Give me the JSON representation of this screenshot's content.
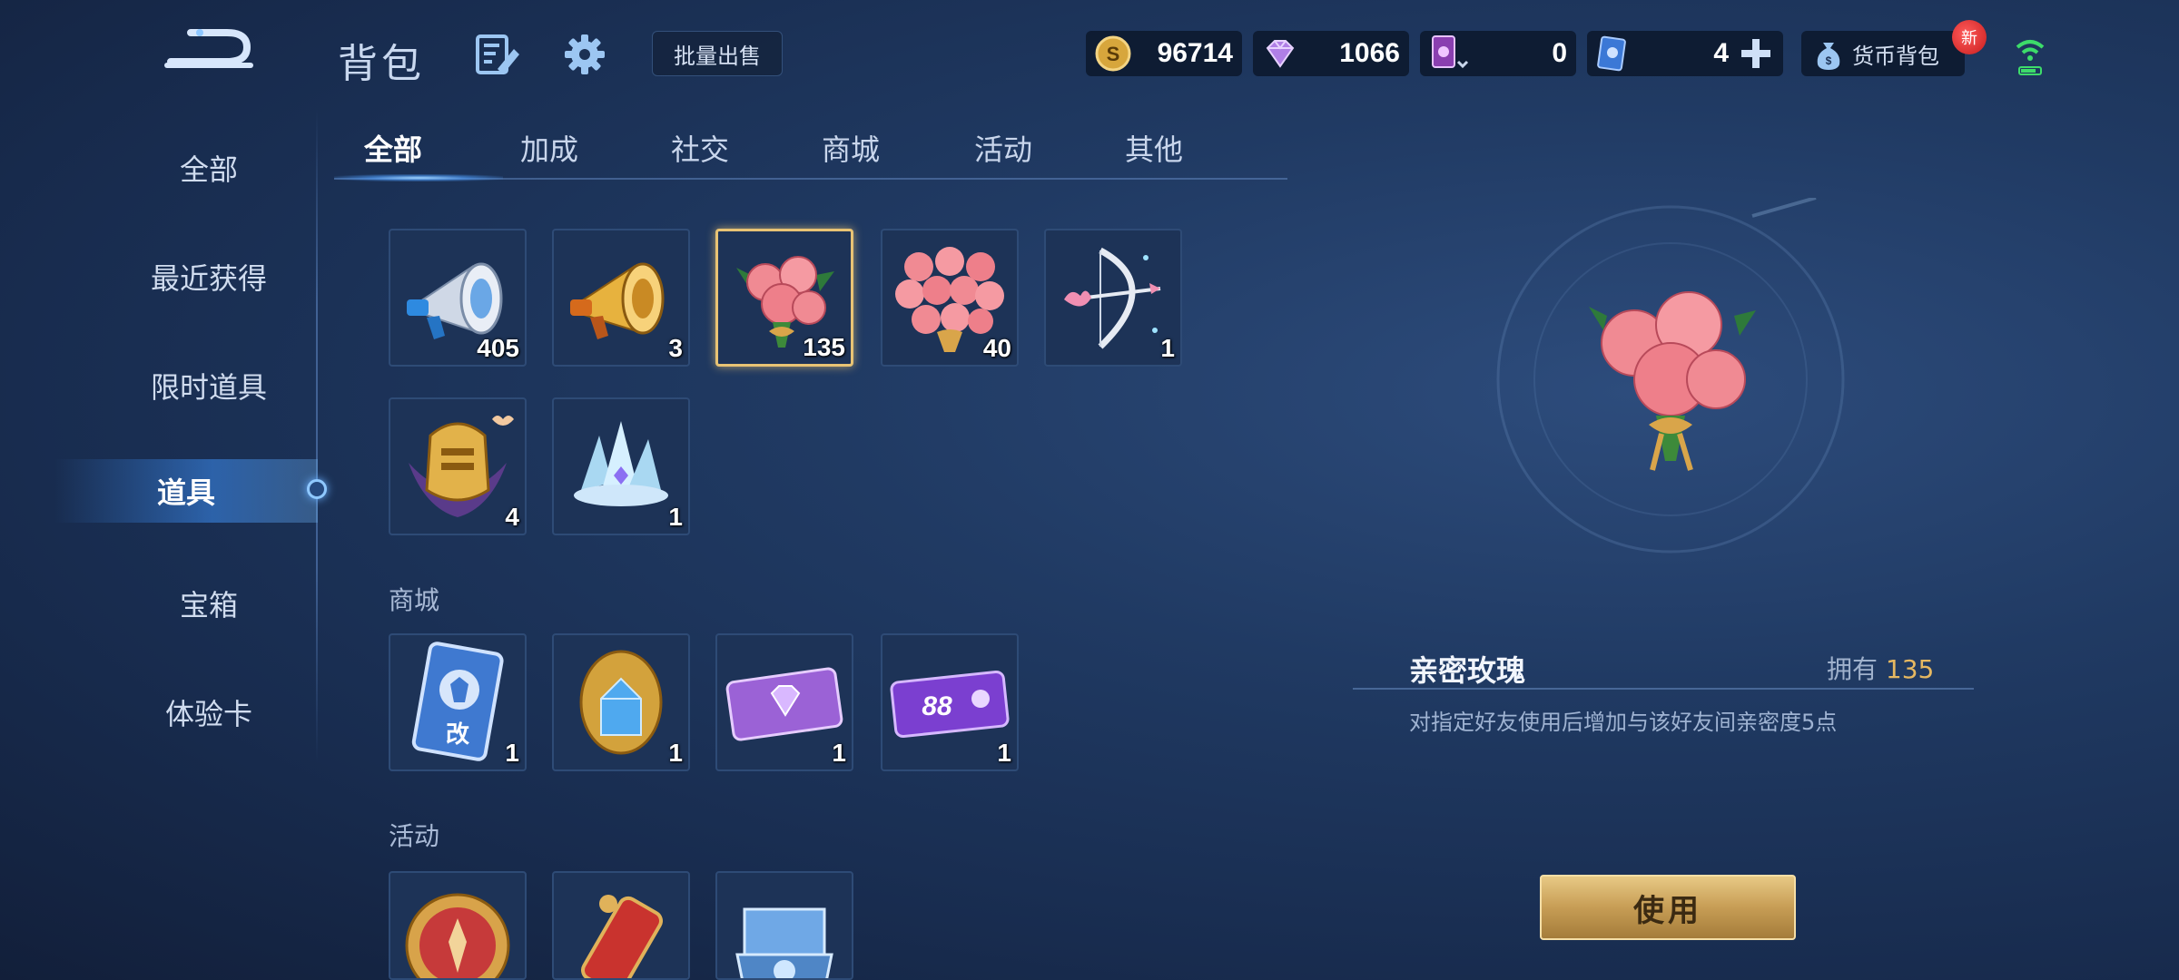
{
  "header": {
    "title": "背包",
    "bulk_sell_label": "批量出售",
    "currencies": [
      {
        "icon": "gold-coin-icon",
        "value": "96714"
      },
      {
        "icon": "diamond-icon",
        "value": "1066"
      },
      {
        "icon": "ticket-icon",
        "value": "0"
      },
      {
        "icon": "card-icon",
        "value": "4"
      }
    ],
    "currency_bag_label": "货币背包",
    "new_badge": "新"
  },
  "sidebar": {
    "items": [
      {
        "label": "全部",
        "active": false
      },
      {
        "label": "最近获得",
        "active": false
      },
      {
        "label": "限时道具",
        "active": false
      },
      {
        "label": "道具",
        "active": true
      },
      {
        "label": "宝箱",
        "active": false
      },
      {
        "label": "体验卡",
        "active": false
      }
    ]
  },
  "tabs": [
    {
      "label": "全部",
      "active": true
    },
    {
      "label": "加成",
      "active": false
    },
    {
      "label": "社交",
      "active": false
    },
    {
      "label": "商城",
      "active": false
    },
    {
      "label": "活动",
      "active": false
    },
    {
      "label": "其他",
      "active": false
    }
  ],
  "sections": {
    "shop_label": "商城",
    "activity_label": "活动"
  },
  "items": {
    "social": [
      {
        "icon": "blue-megaphone-icon",
        "count": "405"
      },
      {
        "icon": "gold-megaphone-icon",
        "count": "3"
      },
      {
        "icon": "rose-bouquet-icon",
        "count": "135",
        "selected": true
      },
      {
        "icon": "large-rose-bouquet-icon",
        "count": "40"
      },
      {
        "icon": "cupid-bow-icon",
        "count": "1"
      },
      {
        "icon": "golden-helmet-icon",
        "count": "4"
      },
      {
        "icon": "ice-crystal-icon",
        "count": "1"
      }
    ],
    "shop": [
      {
        "icon": "rename-card-icon",
        "count": "1"
      },
      {
        "icon": "gem-egg-icon",
        "count": "1"
      },
      {
        "icon": "purple-diamond-ticket-icon",
        "count": "1"
      },
      {
        "icon": "88-coupon-icon",
        "count": "1"
      }
    ],
    "activity": [
      {
        "icon": "red-medal-icon"
      },
      {
        "icon": "scroll-icon"
      },
      {
        "icon": "jewel-box-icon"
      }
    ]
  },
  "detail": {
    "name": "亲密玫瑰",
    "owned_label": "拥有",
    "owned_count": "135",
    "description": "对指定好友使用后增加与该好友间亲密度5点",
    "use_label": "使用"
  },
  "colors": {
    "accent_gold": "#e6b861",
    "background": "#203a63",
    "selected_border": "#e8c374"
  }
}
